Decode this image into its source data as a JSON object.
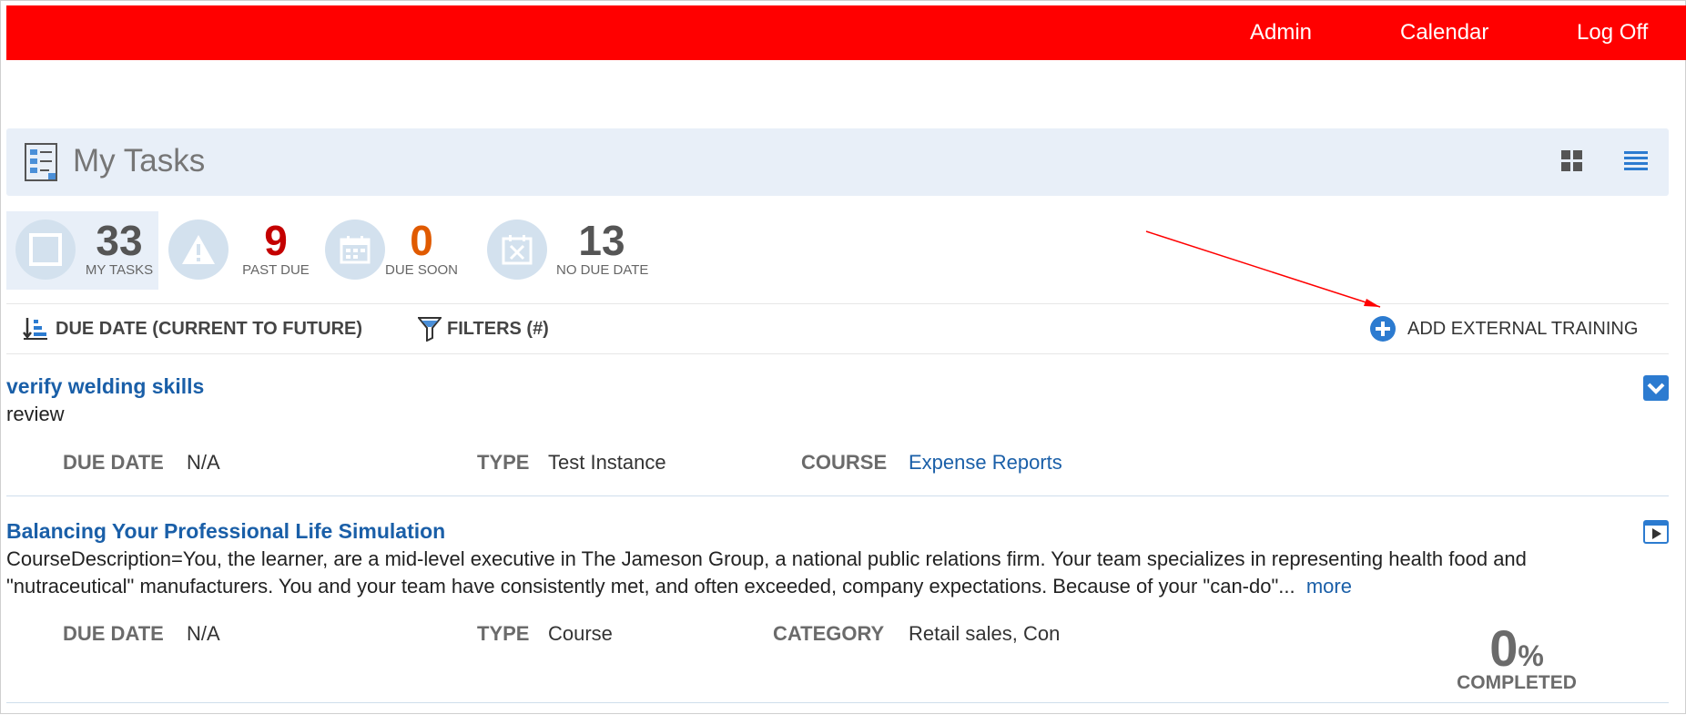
{
  "header": {
    "nav": [
      "Admin",
      "Calendar",
      "Log Off"
    ],
    "bg_color": "#ff0000"
  },
  "page": {
    "title": "My Tasks",
    "title_icon": "task-list-icon",
    "view_icons": [
      "grid-view-icon",
      "list-view-icon"
    ]
  },
  "stats": [
    {
      "value": "33",
      "label": "MY TASKS",
      "icon": "square-icon",
      "color": "#555555"
    },
    {
      "value": "9",
      "label": "PAST DUE",
      "icon": "warning-icon",
      "color": "#c40000"
    },
    {
      "value": "0",
      "label": "DUE SOON",
      "icon": "calendar-icon",
      "color": "#e05a00"
    },
    {
      "value": "13",
      "label": "NO DUE DATE",
      "icon": "calendar-x-icon",
      "color": "#555555"
    }
  ],
  "toolbar": {
    "sort": "DUE DATE (CURRENT TO FUTURE)",
    "filters": "FILTERS (#)",
    "add": "ADD EXTERNAL TRAINING"
  },
  "tasks": [
    {
      "title": "verify welding skills",
      "subtitle": "review",
      "due_label": "DUE DATE",
      "due": "N/A",
      "type_label": "TYPE",
      "type": "Test Instance",
      "course_label": "COURSE",
      "course": "Expense Reports",
      "icon": "expand-chevron-icon"
    },
    {
      "title": "Balancing Your Professional Life Simulation",
      "description": "CourseDescription=You, the learner, are a mid-level executive in The Jameson Group, a national public relations firm. Your team specializes in representing health food and \"nutraceutical\" manufacturers. You and your team have consistently met, and often exceeded, company expectations. Because of your \"can-do\"...",
      "more": "more",
      "due_label": "DUE DATE",
      "due": "N/A",
      "type_label": "TYPE",
      "type": "Course",
      "category_label": "CATEGORY",
      "category": "Retail sales, Con",
      "progress": "0",
      "progress_unit": "%",
      "progress_label": "COMPLETED",
      "icon": "play-course-icon"
    }
  ]
}
